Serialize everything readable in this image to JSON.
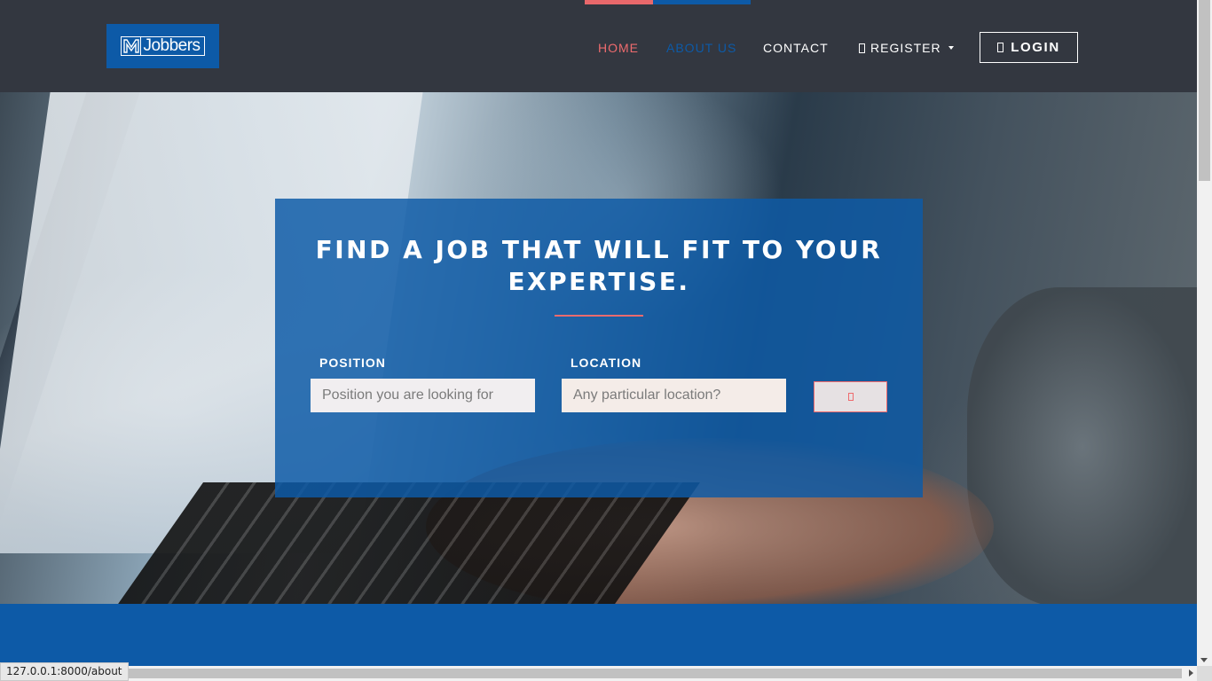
{
  "brand": {
    "logo_text": "Jobbers",
    "accent_red": "#ee6b6e",
    "primary_blue": "#0d5aa7",
    "nav_bg": "#333740"
  },
  "nav": {
    "items": [
      {
        "label": "HOME",
        "state": "active"
      },
      {
        "label": "ABOUT US",
        "state": "hover"
      },
      {
        "label": "CONTACT",
        "state": "normal"
      },
      {
        "label": "REGISTER",
        "state": "dropdown",
        "icon": "user-icon"
      }
    ],
    "login_label": "LOGIN",
    "login_icon": "sign-in-icon"
  },
  "hero": {
    "title": "FIND A JOB THAT WILL FIT TO YOUR EXPERTISE.",
    "position_label": "POSITION",
    "position_placeholder": "Position you are looking for",
    "location_label": "LOCATION",
    "location_placeholder": "Any particular location?",
    "search_icon": "search-icon"
  },
  "status_bar": {
    "url": "127.0.0.1:8000/about"
  }
}
